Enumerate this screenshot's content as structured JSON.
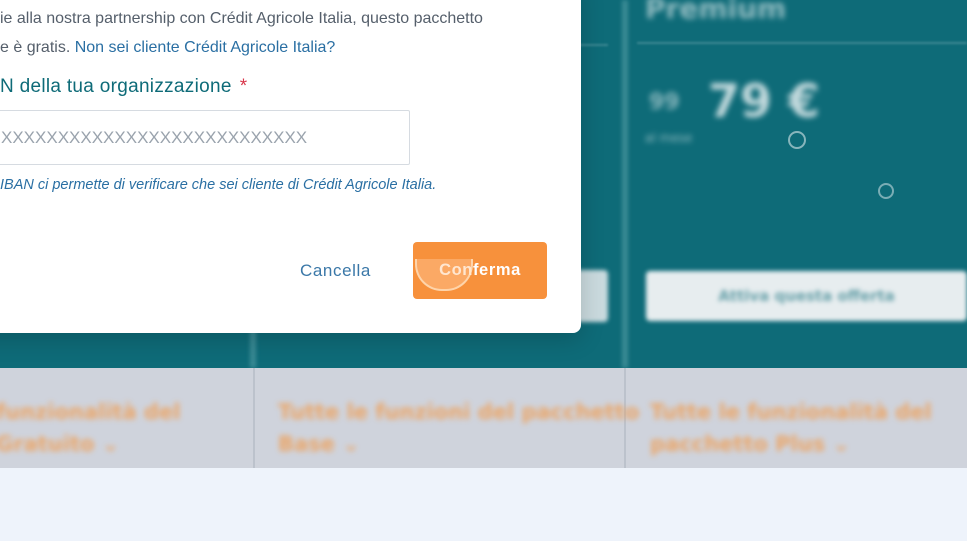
{
  "colors": {
    "teal": "#0e6b78",
    "orange": "#f7913c",
    "link": "#2a6fa3",
    "required": "#d9374b"
  },
  "background": {
    "plan_title": "Premium",
    "plan_old_price": "99",
    "plan_price": "79 €",
    "plan_per_period": "al mese",
    "plan_note": "",
    "plan_button": "Attiva questa offerta",
    "features": [
      {
        "line1": "funzionalità del",
        "line2": "Gratuito"
      },
      {
        "line1": "Tutte le funzioni del pacchetto",
        "line2": "Base"
      },
      {
        "line1": "Tutte le funzionalità del",
        "line2": "pacchetto Plus"
      }
    ]
  },
  "modal": {
    "intro_line1": "ie alla nostra partnership con Crédit Agricole Italia, questo pacchetto",
    "intro_line2": "e è gratis.",
    "intro_link": "Non sei cliente Crédit Agricole Italia?",
    "field_label": "N della tua organizzazione",
    "required_mark": "*",
    "iban_placeholder": "XXXXXXXXXXXXXXXXXXXXXXXXXXX",
    "help_text": "IBAN ci permette di verificare che sei cliente di Crédit Agricole Italia.",
    "cancel_label": "Cancella",
    "confirm_label": "Conferma"
  }
}
